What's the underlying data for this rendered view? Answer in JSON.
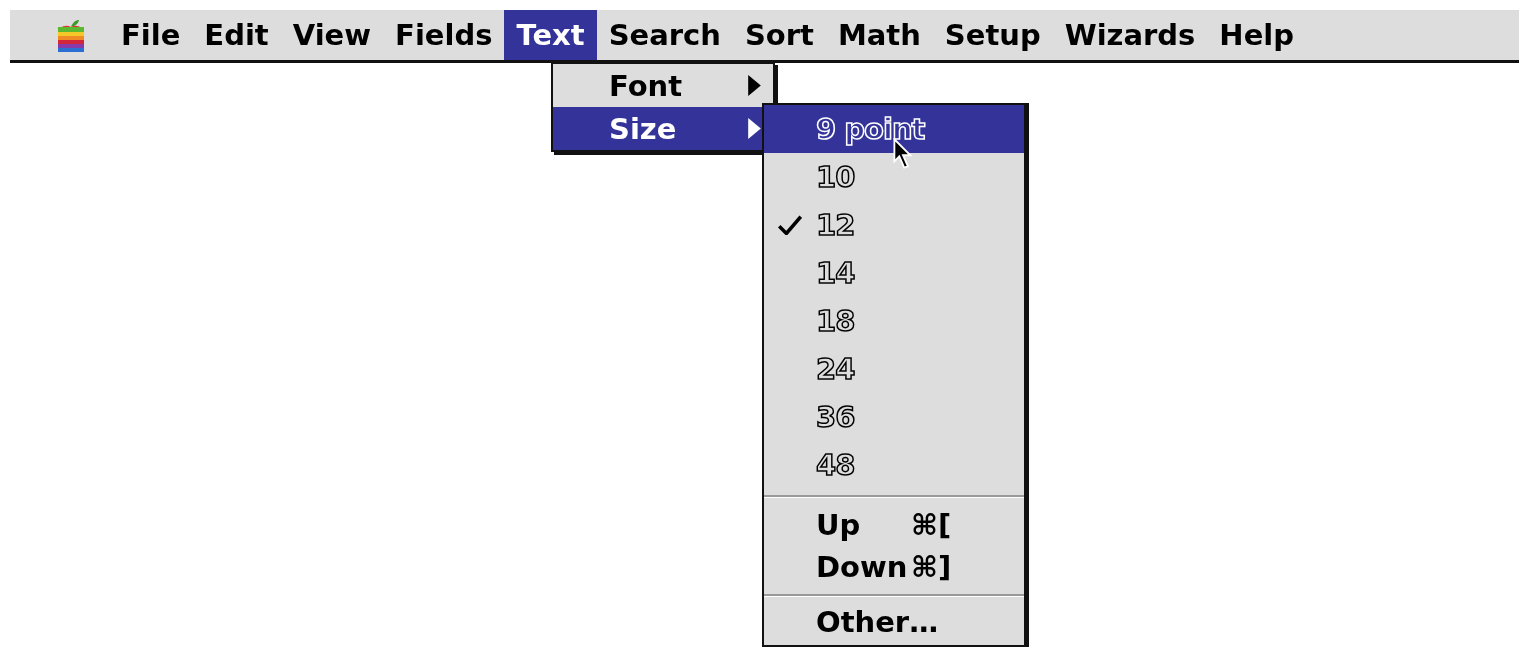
{
  "menu_bar": {
    "items": [
      {
        "label": "File",
        "selected": false
      },
      {
        "label": "Edit",
        "selected": false
      },
      {
        "label": "View",
        "selected": false
      },
      {
        "label": "Fields",
        "selected": false
      },
      {
        "label": "Text",
        "selected": true
      },
      {
        "label": "Search",
        "selected": false
      },
      {
        "label": "Sort",
        "selected": false
      },
      {
        "label": "Math",
        "selected": false
      },
      {
        "label": "Setup",
        "selected": false
      },
      {
        "label": "Wizards",
        "selected": false
      },
      {
        "label": "Help",
        "selected": false
      }
    ]
  },
  "text_menu": {
    "items": [
      {
        "label": "Font",
        "selected": false,
        "submenu": true
      },
      {
        "label": "Size",
        "selected": true,
        "submenu": true
      }
    ]
  },
  "size_menu": {
    "items": [
      {
        "kind": "size",
        "label": "9 point",
        "selected": true,
        "checked": false
      },
      {
        "kind": "size",
        "label": "10",
        "selected": false,
        "checked": false
      },
      {
        "kind": "size",
        "label": "12",
        "selected": false,
        "checked": true
      },
      {
        "kind": "size",
        "label": "14",
        "selected": false,
        "checked": false
      },
      {
        "kind": "size",
        "label": "18",
        "selected": false,
        "checked": false
      },
      {
        "kind": "size",
        "label": "24",
        "selected": false,
        "checked": false
      },
      {
        "kind": "size",
        "label": "36",
        "selected": false,
        "checked": false
      },
      {
        "kind": "size",
        "label": "48",
        "selected": false,
        "checked": false
      },
      {
        "kind": "separator"
      },
      {
        "kind": "command",
        "label": "Up",
        "shortcut": "⌘[",
        "selected": false
      },
      {
        "kind": "command",
        "label": "Down",
        "shortcut": "⌘]",
        "selected": false
      },
      {
        "kind": "separator"
      },
      {
        "kind": "command",
        "label": "Other…",
        "selected": false
      }
    ]
  }
}
